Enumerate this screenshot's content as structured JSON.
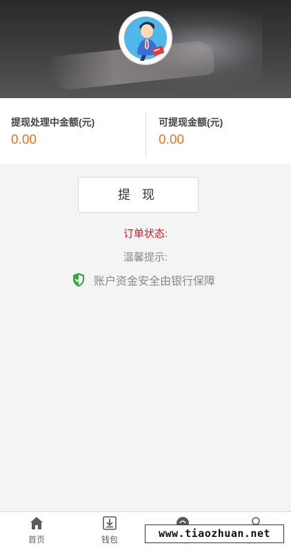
{
  "balances": {
    "processing_label": "提现处理中金额(元)",
    "processing_value": "0.00",
    "available_label": "可提现金额(元)",
    "available_value": "0.00"
  },
  "withdraw_button_label": "提 现",
  "order_status_label": "订单状态:",
  "tip_label": "温馨提示:",
  "security_text": "账户资金安全由银行保障",
  "tabs": [
    {
      "label": "首页",
      "icon": "home-icon"
    },
    {
      "label": "钱包",
      "icon": "wallet-download-icon"
    },
    {
      "label": "客服",
      "icon": "customer-service-icon"
    },
    {
      "label": "我的",
      "icon": "user-icon"
    }
  ],
  "watermark": "www.tiaozhuan.net",
  "colors": {
    "amount": "#e5731f",
    "order_status": "#c81e1e",
    "shield": "#2eaa3a"
  }
}
